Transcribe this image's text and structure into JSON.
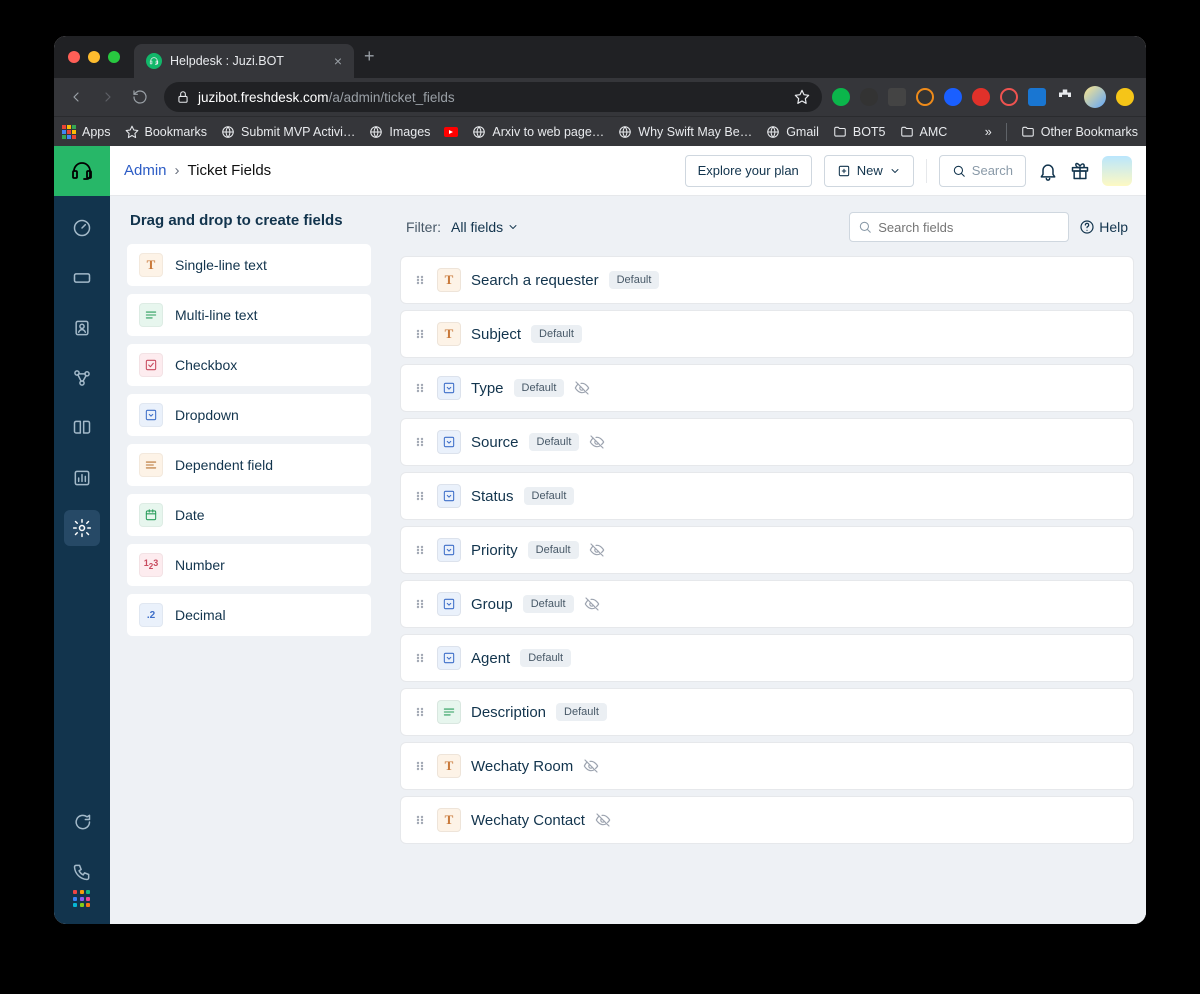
{
  "browser": {
    "tab_title": "Helpdesk : Juzi.BOT",
    "url_domain": "juzibot.freshdesk.com",
    "url_path": "/a/admin/ticket_fields",
    "bookmarks": [
      "Apps",
      "Bookmarks",
      "Submit MVP Activi…",
      "Images",
      "Arxiv to web page…",
      "Why Swift May Be…",
      "Gmail",
      "BOT5",
      "AMC"
    ],
    "bookmarks_overflow": "»",
    "other_bookmarks": "Other Bookmarks"
  },
  "topbar": {
    "breadcrumb_root": "Admin",
    "breadcrumb_current": "Ticket Fields",
    "explore_button": "Explore your plan",
    "new_button": "New",
    "search_placeholder": "Search"
  },
  "left_panel": {
    "heading": "Drag and drop to create fields",
    "field_types": [
      {
        "icon": "text",
        "label": "Single-line text"
      },
      {
        "icon": "multiline",
        "label": "Multi-line text"
      },
      {
        "icon": "checkbox",
        "label": "Checkbox"
      },
      {
        "icon": "dropdown",
        "label": "Dropdown"
      },
      {
        "icon": "dependent",
        "label": "Dependent field"
      },
      {
        "icon": "date",
        "label": "Date"
      },
      {
        "icon": "number",
        "label": "Number"
      },
      {
        "icon": "decimal",
        "label": "Decimal"
      }
    ]
  },
  "right_panel": {
    "filter_label": "Filter:",
    "filter_value": "All fields",
    "search_placeholder": "Search fields",
    "help_label": "Help",
    "default_badge": "Default",
    "fields": [
      {
        "icon": "text",
        "name": "Search a requester",
        "default": true,
        "hidden": false
      },
      {
        "icon": "text",
        "name": "Subject",
        "default": true,
        "hidden": false
      },
      {
        "icon": "dropdown",
        "name": "Type",
        "default": true,
        "hidden": true
      },
      {
        "icon": "dropdown",
        "name": "Source",
        "default": true,
        "hidden": true
      },
      {
        "icon": "dropdown",
        "name": "Status",
        "default": true,
        "hidden": false
      },
      {
        "icon": "dropdown",
        "name": "Priority",
        "default": true,
        "hidden": true
      },
      {
        "icon": "dropdown",
        "name": "Group",
        "default": true,
        "hidden": true
      },
      {
        "icon": "dropdown",
        "name": "Agent",
        "default": true,
        "hidden": false
      },
      {
        "icon": "multiline",
        "name": "Description",
        "default": true,
        "hidden": false
      },
      {
        "icon": "text",
        "name": "Wechaty Room",
        "default": false,
        "hidden": true
      },
      {
        "icon": "text",
        "name": "Wechaty Contact",
        "default": false,
        "hidden": true
      }
    ]
  }
}
